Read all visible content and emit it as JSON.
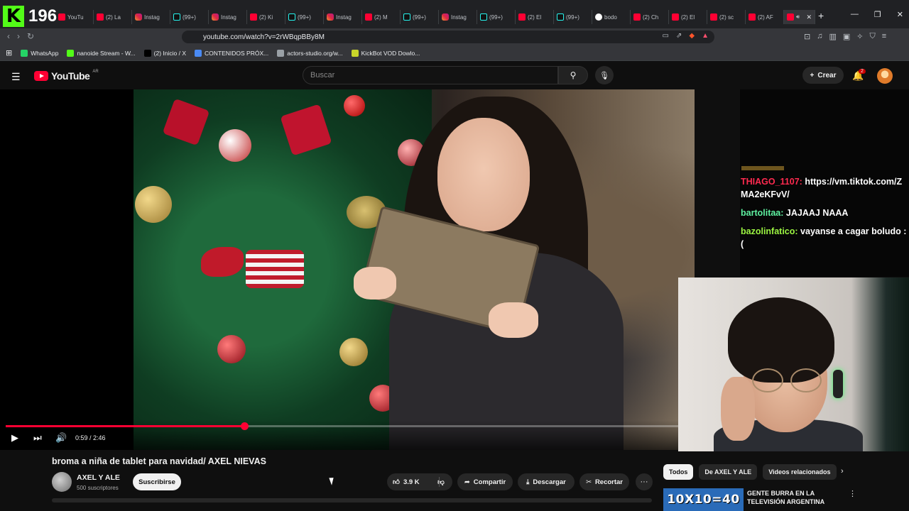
{
  "kick": {
    "count": "196"
  },
  "browser": {
    "tabs": [
      {
        "icon": "yt",
        "label": "YouTu"
      },
      {
        "icon": "yt",
        "label": "(2) La"
      },
      {
        "icon": "ig",
        "label": "Instag"
      },
      {
        "icon": "tt",
        "label": "(99+)"
      },
      {
        "icon": "ig",
        "label": "Instag"
      },
      {
        "icon": "yt",
        "label": "(2) Ki"
      },
      {
        "icon": "tt",
        "label": "(99+)"
      },
      {
        "icon": "ig",
        "label": "Instag"
      },
      {
        "icon": "yt",
        "label": "(2) M"
      },
      {
        "icon": "tt",
        "label": "(99+)"
      },
      {
        "icon": "ig",
        "label": "Instag"
      },
      {
        "icon": "tt",
        "label": "(99+)"
      },
      {
        "icon": "yt",
        "label": "(2) El"
      },
      {
        "icon": "tt",
        "label": "(99+)"
      },
      {
        "icon": "g",
        "label": "bodo"
      },
      {
        "icon": "yt",
        "label": "(2) Ch"
      },
      {
        "icon": "yt",
        "label": "(2) El"
      },
      {
        "icon": "yt",
        "label": "(2) sc"
      },
      {
        "icon": "yt",
        "label": "(2) AF"
      }
    ],
    "url": "youtube.com/watch?v=2rWBqpBBy8M",
    "bookmarks": [
      {
        "label": "WhatsApp",
        "color": "#25d366"
      },
      {
        "label": "nanoide Stream - W...",
        "color": "#53fc18"
      },
      {
        "label": "(2) Inicio / X",
        "color": "#000000"
      },
      {
        "label": "CONTENIDOS PRÓX...",
        "color": "#4a8af4"
      },
      {
        "label": "actors-studio.org/w...",
        "color": "#9aa0a6"
      },
      {
        "label": "KickBot VOD Dowlo...",
        "color": "#c9d52a"
      }
    ]
  },
  "youtube": {
    "logo_text": "YouTube",
    "region": "AR",
    "search_placeholder": "Buscar",
    "create_label": "Crear",
    "notifications_count": "2"
  },
  "player": {
    "current_time": "0:59",
    "duration": "2:46",
    "time_display": "0:59 / 2:46",
    "progress": 0.355
  },
  "chat": [
    {
      "user": "THIAGO_1107:",
      "color": "#ff2a4f",
      "message": "https://vm.tiktok.com/ZMA2eKFvV/"
    },
    {
      "user": "bartolitaa:",
      "color": "#5ef0a0",
      "message": "JAJAAJ NAAA"
    },
    {
      "user": "bazolinfatico:",
      "color": "#9cf542",
      "message": "vayanse a cagar boludo :("
    }
  ],
  "video": {
    "title": "broma a niña de tablet para navidad/ AXEL NIEVAS",
    "channel": "AXEL Y ALE",
    "subscribers": "500 suscriptores",
    "subscribe_label": "Suscribirse",
    "likes": "3.9 K",
    "share_label": "Compartir",
    "download_label": "Descargar",
    "clip_label": "Recortar"
  },
  "sidebar": {
    "chips": [
      "Todos",
      "De AXEL Y ALE",
      "Videos relacionados"
    ],
    "recommendation": {
      "thumb_text": "10X10=40",
      "title": "GENTE BURRA EN LA TELEVISIÓN ARGENTINA"
    }
  }
}
